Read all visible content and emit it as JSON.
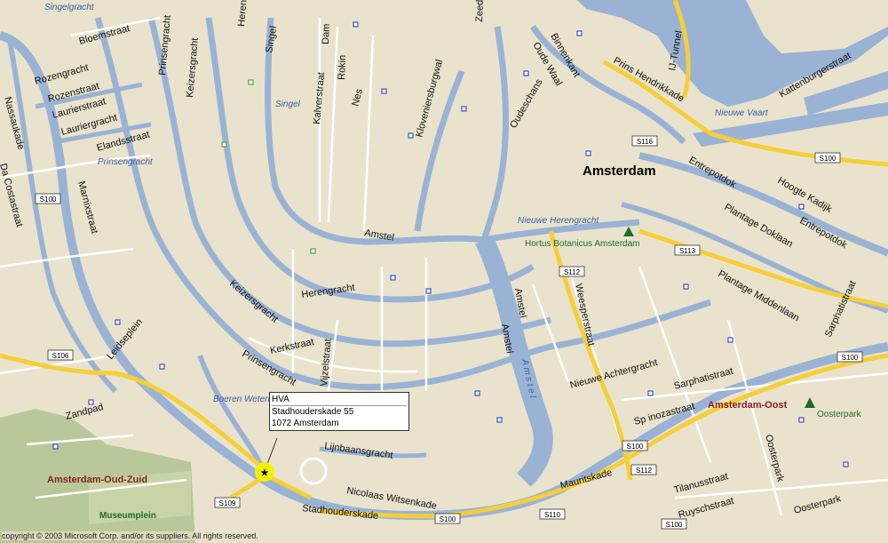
{
  "map": {
    "city_label": "Amsterdam",
    "districts": [
      "Amsterdam-Oud-Zuid",
      "Amsterdam-Oost"
    ],
    "parks": [
      "Museumplein",
      "Oosterpark",
      "Hortus Botanicus Amsterdam"
    ],
    "water_labels": [
      "Singel",
      "Prinsengracht",
      "Singelgracht",
      "Nieuwe Vaart",
      "Nieuwe Herengracht",
      "Boeren Wetering",
      "A m s t e l"
    ],
    "street_labels": [
      "Bloemstraat",
      "Rozengracht",
      "Rozenstraat",
      "Laurierstraat",
      "Lauriergracht",
      "Elandsstraat",
      "Nassaukade",
      "Da Costastraat",
      "Marnixstraat",
      "Prinsengracht",
      "Keizersgracht",
      "Herengracht",
      "Singel",
      "Dam",
      "Rokin",
      "Nes",
      "Kalverstraat",
      "Kloveniersburgwal",
      "Zeedijk",
      "Oude Waal",
      "Binnenkant",
      "Oudeschans",
      "Prins Hendrikkade",
      "IJ-Tunnel",
      "Kattenburgerstraat",
      "Entrepotdok",
      "Hoogte Kadijk",
      "Plantage Doklaan",
      "Entrepotdok",
      "Plantage Middenlaan",
      "Sarphatistraat",
      "Amstel",
      "Weesperstraat",
      "Nieuwe Achtergracht",
      "Sarphatistraat",
      "Sp inozastraat",
      "Mauritskade",
      "Tilanusstraat",
      "Ruyschstraat",
      "Oosterpark",
      "Oosterpark",
      "Amstel",
      "Lijnbaansgracht",
      "Nicolaas Witsenkade",
      "Stadhouderskade",
      "Kerkstraat",
      "Prinsengracht",
      "Vijzelstraat",
      "Keizersgracht",
      "Leidseplein",
      "Zandpad",
      "Herengracht",
      "Amstel"
    ],
    "route_shields": [
      "S116",
      "S100",
      "S100",
      "S112",
      "S113",
      "S100",
      "S106",
      "S100",
      "S112",
      "S109",
      "S100",
      "S110",
      "S100"
    ]
  },
  "callout": {
    "line1": "HVA",
    "line2": "Stadhouderskade 55",
    "line3": "1072 Amsterdam"
  },
  "copyright": "copyright © 2003 Microsoft Corp. and/or its suppliers. All rights reserved."
}
